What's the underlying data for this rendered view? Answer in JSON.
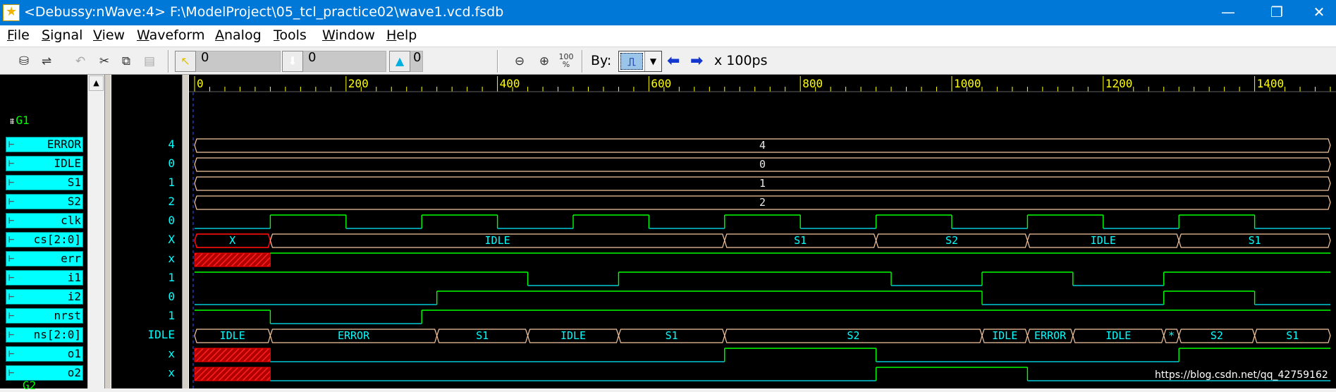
{
  "window": {
    "title": "<Debussy:nWave:4> F:\\ModelProject\\05_tcl_practice02\\wave1.vcd.fsdb",
    "controls": [
      "—",
      "❐",
      "✕"
    ]
  },
  "menu": [
    {
      "label": "File",
      "mn": "F",
      "rest": "ile"
    },
    {
      "label": "Signal",
      "mn": "S",
      "rest": "ignal"
    },
    {
      "label": "View",
      "mn": "V",
      "rest": "iew"
    },
    {
      "label": "Waveform",
      "mn": "W",
      "rest": "aveform"
    },
    {
      "label": "Analog",
      "mn": "A",
      "rest": "nalog"
    },
    {
      "label": "Tools",
      "mn": "T",
      "rest": "ools"
    },
    {
      "label": "Window",
      "mn": "W",
      "rest": "indow"
    },
    {
      "label": "Help",
      "mn": "H",
      "rest": "elp"
    }
  ],
  "toolbar": {
    "cursor_value": "0",
    "marker_value": "0",
    "delta_value": "0",
    "by_label": "By:",
    "unit": "x 100ps",
    "zoom_fit": "100\n%"
  },
  "ruler": {
    "labels": [
      "0",
      "200",
      "400",
      "600",
      "800",
      "1000",
      "1200",
      "1400"
    ],
    "t_start": 0,
    "t_end": 1500
  },
  "groups": [
    {
      "name": "G1"
    },
    {
      "name": "G2"
    }
  ],
  "signals": [
    {
      "name": "ERROR",
      "value": "4",
      "type": "const",
      "text": "4"
    },
    {
      "name": "IDLE",
      "value": "0",
      "type": "const",
      "text": "0"
    },
    {
      "name": "S1",
      "value": "1",
      "type": "const",
      "text": "1"
    },
    {
      "name": "S2",
      "value": "2",
      "type": "const",
      "text": "2"
    },
    {
      "name": "clk",
      "value": "0",
      "type": "bit",
      "init": 0,
      "edges": [
        100,
        200,
        300,
        400,
        500,
        600,
        700,
        800,
        900,
        1000,
        1100,
        1200,
        1300,
        1400,
        1500
      ]
    },
    {
      "name": "cs[2:0]",
      "value": "X",
      "type": "bus",
      "segments": [
        [
          0,
          100,
          "X"
        ],
        [
          100,
          700,
          "IDLE"
        ],
        [
          700,
          900,
          "S1"
        ],
        [
          900,
          1100,
          "S2"
        ],
        [
          1100,
          1300,
          "IDLE"
        ],
        [
          1300,
          1500,
          "S1"
        ]
      ]
    },
    {
      "name": "err",
      "value": "x",
      "type": "bit",
      "xuntil": 100,
      "init": 1,
      "edges": []
    },
    {
      "name": "i1",
      "value": "1",
      "type": "bit",
      "init": 1,
      "edges": [
        440,
        560,
        920,
        1040,
        1160,
        1280
      ]
    },
    {
      "name": "i2",
      "value": "0",
      "type": "bit",
      "init": 0,
      "edges": [
        320,
        1040,
        1280,
        1400
      ]
    },
    {
      "name": "nrst",
      "value": "1",
      "type": "bit",
      "init": 1,
      "edges": [
        100,
        300
      ]
    },
    {
      "name": "ns[2:0]",
      "value": "IDLE",
      "type": "bus",
      "segments": [
        [
          0,
          100,
          "IDLE"
        ],
        [
          100,
          320,
          "ERROR"
        ],
        [
          320,
          440,
          "S1"
        ],
        [
          440,
          560,
          "IDLE"
        ],
        [
          560,
          700,
          "S1"
        ],
        [
          700,
          1040,
          "S2"
        ],
        [
          1040,
          1100,
          "IDLE"
        ],
        [
          1100,
          1160,
          "ERROR"
        ],
        [
          1160,
          1280,
          "IDLE"
        ],
        [
          1280,
          1300,
          "*"
        ],
        [
          1300,
          1400,
          "S2"
        ],
        [
          1400,
          1500,
          "S1"
        ]
      ]
    },
    {
      "name": "o1",
      "value": "x",
      "type": "bit",
      "xuntil": 100,
      "init": 0,
      "edges": [
        700,
        900,
        1300
      ]
    },
    {
      "name": "o2",
      "value": "x",
      "type": "bit",
      "xuntil": 100,
      "init": 0,
      "edges": [
        900,
        1100
      ]
    }
  ],
  "watermark": "https://blog.csdn.net/qq_42759162",
  "colors": {
    "bit_high": "#00ff00",
    "bit_low": "#00c8d8",
    "bus_edge": "#f4c7a0",
    "const_edge": "#f4c7a0",
    "x_fill": "#ff0000",
    "ruler": "#ffff00"
  }
}
